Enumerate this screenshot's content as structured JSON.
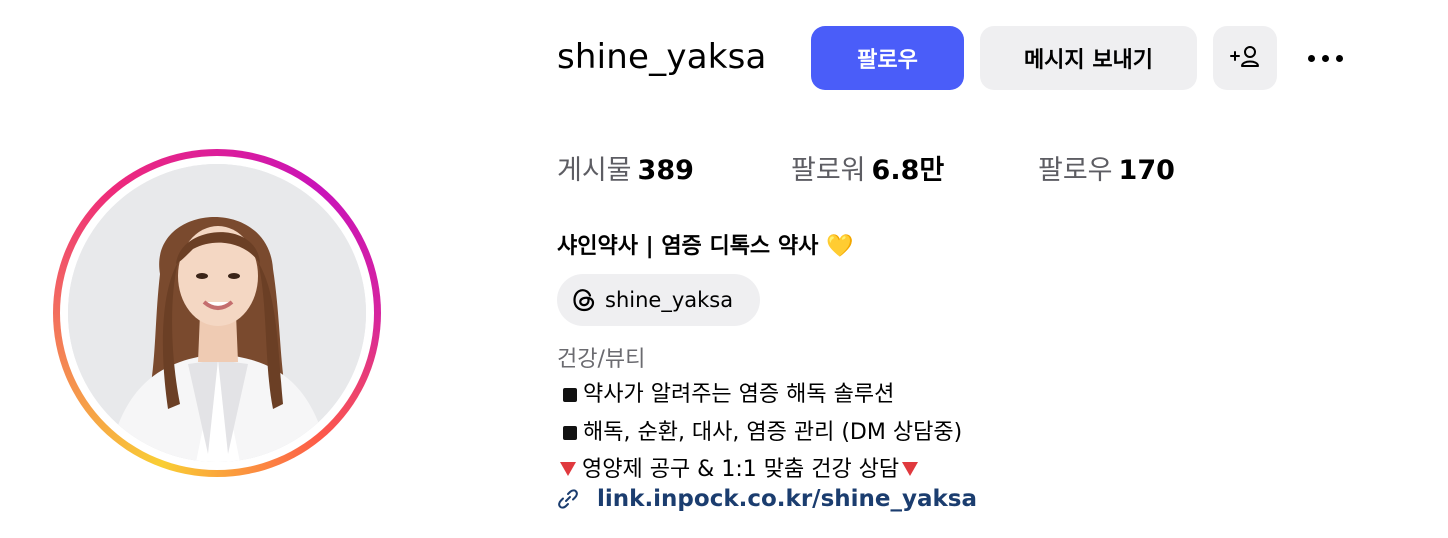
{
  "profile": {
    "username": "shine_yaksa",
    "avatar_alt": "profile photo"
  },
  "actions": {
    "follow_label": "팔로우",
    "message_label": "메시지 보내기",
    "add_user_label": "+",
    "more_icon": "more-horizontal-icon"
  },
  "stats": {
    "posts_label": "게시물",
    "posts_value": "389",
    "followers_label": "팔로워",
    "followers_value": "6.8만",
    "following_label": "팔로우",
    "following_value": "170"
  },
  "bio": {
    "full_name": "샤인약사 |  염증 디톡스 약사",
    "name_emoji": "💛",
    "threads_handle": "shine_yaksa",
    "category": "건강/뷰티",
    "line1": "약사가 알려주는 염증 해독 솔루션",
    "line2": "해독, 순환, 대사, 염증 관리 (DM 상담중)",
    "line3": "영양제 공구 & 1:1 맞춤 건강 상담",
    "link": "link.inpock.co.kr/shine_yaksa"
  },
  "colors": {
    "follow_button": "#4a5df9",
    "secondary_button": "#efeff1",
    "link": "#1b3d6f",
    "category_text": "#6b6b70"
  }
}
